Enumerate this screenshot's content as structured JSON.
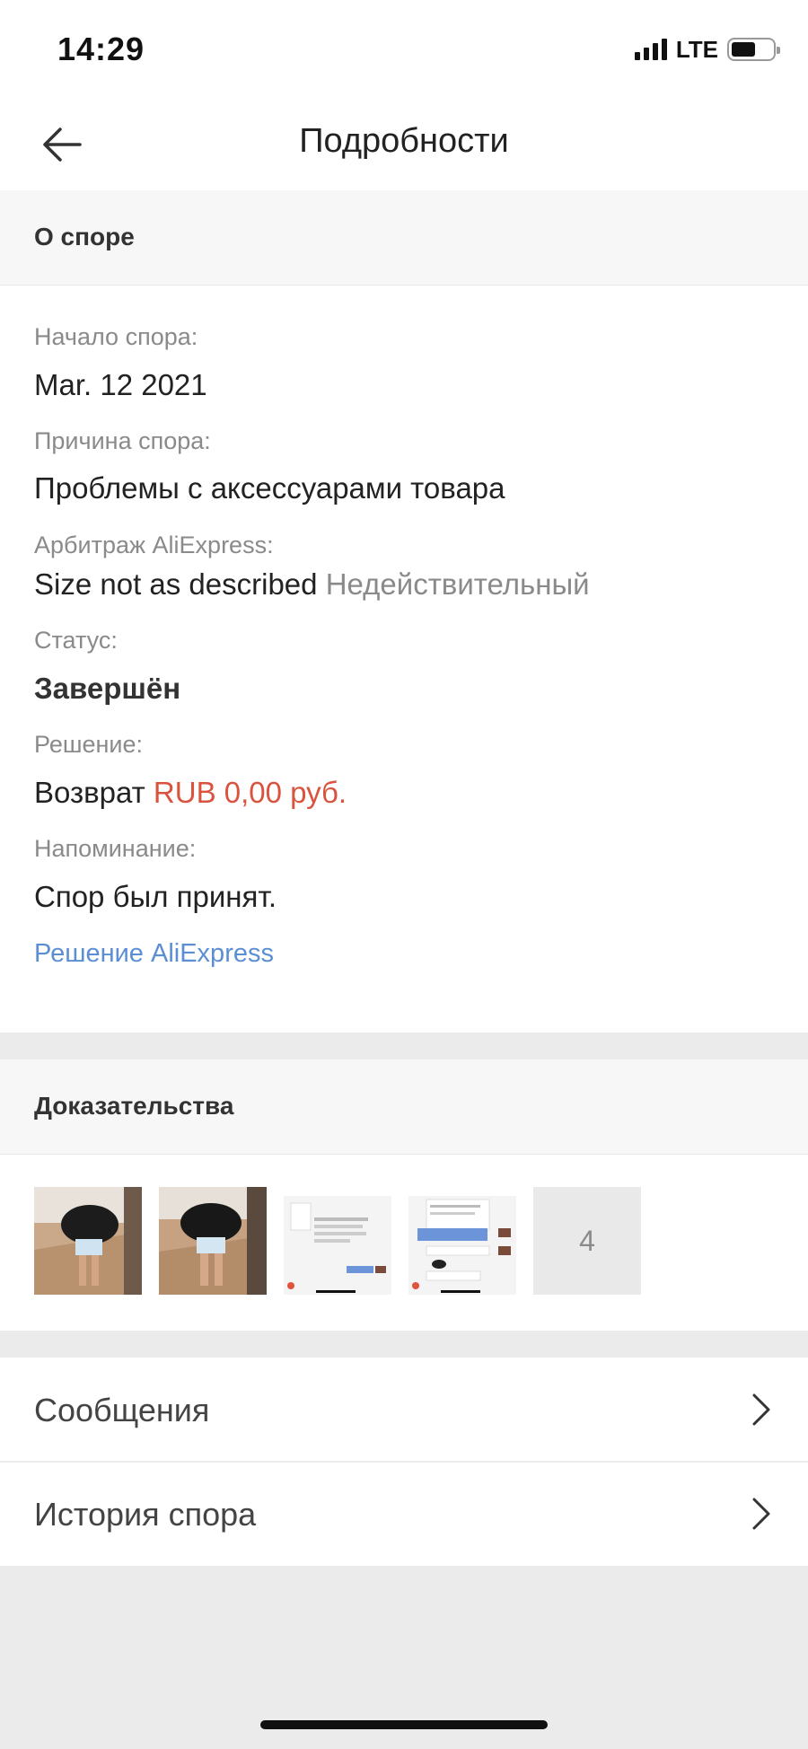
{
  "status_bar": {
    "time": "14:29",
    "network": "LTE",
    "icons": [
      "signal-icon",
      "battery-icon"
    ]
  },
  "nav": {
    "title": "Подробности",
    "back_icon": "arrow-left-icon"
  },
  "dispute_section": {
    "header": "О споре",
    "start_label": "Начало спора:",
    "start_value": "Mar. 12 2021",
    "reason_label": "Причина спора:",
    "reason_value": "Проблемы с аксессуарами товара",
    "arbitration_label": "Арбитраж AliExpress:",
    "arbitration_value": "Size not as described",
    "arbitration_status": "Недействительный",
    "status_label": "Статус:",
    "status_value": "Завершён",
    "decision_label": "Решение:",
    "decision_prefix": "Возврат",
    "decision_amount": "RUB 0,00 руб.",
    "reminder_label": "Напоминание:",
    "reminder_value": "Спор был принят.",
    "aliexpress_decision_link": "Решение AliExpress"
  },
  "evidence_section": {
    "header": "Доказательства",
    "thumbnails": [
      "photo-1",
      "photo-2",
      "screenshot-1",
      "screenshot-2"
    ],
    "more_count": "4"
  },
  "links": [
    {
      "label": "Сообщения",
      "icon": "chevron-right-icon"
    },
    {
      "label": "История спора",
      "icon": "chevron-right-icon"
    }
  ],
  "colors": {
    "accent_red": "#d9533f",
    "link_blue": "#5b8fd3",
    "label_gray": "#8a8a8a",
    "background": "#ebebeb"
  }
}
